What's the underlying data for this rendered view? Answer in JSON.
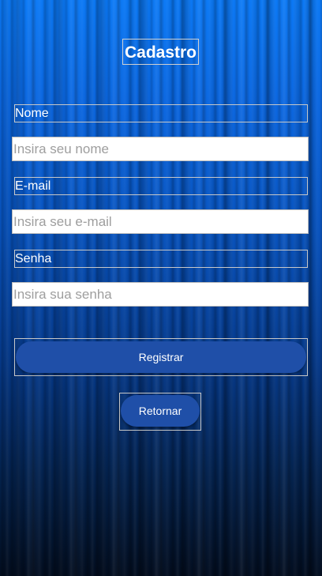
{
  "screen": {
    "title": "Cadastro"
  },
  "form": {
    "name_label": "Nome",
    "name_placeholder": "Insira seu nome",
    "email_label": "E-mail",
    "email_placeholder": "Insira seu e-mail",
    "password_label": "Senha",
    "password_placeholder": "Insira sua senha"
  },
  "actions": {
    "register_label": "Registrar",
    "back_label": "Retornar"
  },
  "colors": {
    "background_top": "#0a78f5",
    "background_bottom": "#020d1f",
    "button": "#1f4fa8"
  }
}
